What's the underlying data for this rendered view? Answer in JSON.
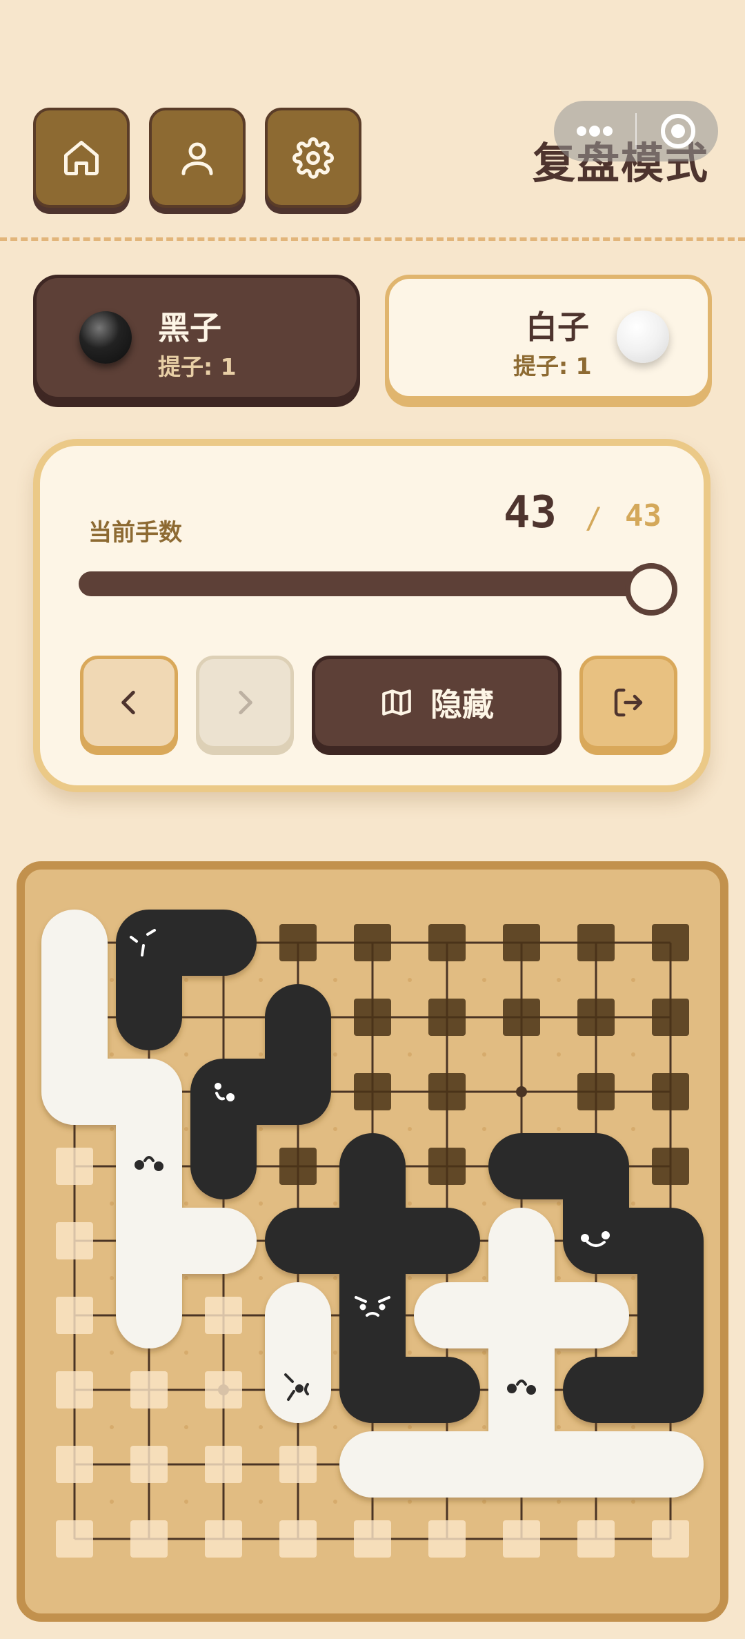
{
  "header": {
    "mode_title": "复盘模式",
    "buttons": [
      {
        "name": "home",
        "icon": "home-icon"
      },
      {
        "name": "profile",
        "icon": "user-icon"
      },
      {
        "name": "settings",
        "icon": "gear-icon"
      }
    ],
    "capsule_icons": [
      "more-dots-icon",
      "target-close-icon"
    ]
  },
  "players": {
    "black": {
      "name": "黑子",
      "captures": "提子: 1"
    },
    "white": {
      "name": "白子",
      "captures": "提子: 1"
    }
  },
  "replay": {
    "label": "当前手数",
    "current": "43",
    "separator": "/",
    "total": "43",
    "progress": 1.0,
    "hide_label": "隐藏",
    "prev_icon": "chevron-left-icon",
    "next_icon": "chevron-right-icon",
    "hide_icon": "map-icon",
    "exit_icon": "exit-icon"
  },
  "board": {
    "size": 9,
    "star_points": [
      [
        6,
        2
      ],
      [
        2,
        6
      ]
    ],
    "black_groups": [
      {
        "face": "surprised",
        "cells": [
          [
            1,
            0
          ],
          [
            2,
            0
          ],
          [
            1,
            1
          ]
        ]
      },
      {
        "face": "confused",
        "cells": [
          [
            3,
            1
          ],
          [
            3,
            2
          ],
          [
            2,
            2
          ],
          [
            2,
            3
          ]
        ]
      },
      {
        "face": "angry",
        "cells": [
          [
            4,
            3
          ],
          [
            4,
            4
          ],
          [
            3,
            4
          ],
          [
            5,
            4
          ],
          [
            4,
            5
          ],
          [
            4,
            6
          ],
          [
            5,
            6
          ]
        ]
      },
      {
        "face": "smile",
        "cells": [
          [
            6,
            3
          ],
          [
            7,
            3
          ],
          [
            7,
            4
          ],
          [
            8,
            4
          ],
          [
            8,
            5
          ],
          [
            8,
            6
          ],
          [
            7,
            6
          ]
        ]
      }
    ],
    "white_groups": [
      {
        "face": "sleepy",
        "cells": [
          [
            0,
            0
          ],
          [
            0,
            1
          ],
          [
            0,
            2
          ],
          [
            1,
            2
          ],
          [
            1,
            3
          ],
          [
            1,
            4
          ],
          [
            2,
            4
          ],
          [
            1,
            5
          ]
        ]
      },
      {
        "face": "dizzy",
        "cells": [
          [
            3,
            5
          ],
          [
            3,
            6
          ]
        ]
      },
      {
        "face": "sleepy",
        "cells": [
          [
            6,
            4
          ],
          [
            6,
            5
          ],
          [
            5,
            5
          ],
          [
            7,
            5
          ],
          [
            6,
            6
          ],
          [
            6,
            7
          ],
          [
            4,
            7
          ],
          [
            5,
            7
          ],
          [
            7,
            7
          ],
          [
            8,
            7
          ]
        ]
      }
    ],
    "black_territory": [
      [
        3,
        0
      ],
      [
        4,
        0
      ],
      [
        5,
        0
      ],
      [
        6,
        0
      ],
      [
        7,
        0
      ],
      [
        8,
        0
      ],
      [
        4,
        1
      ],
      [
        5,
        1
      ],
      [
        6,
        1
      ],
      [
        7,
        1
      ],
      [
        8,
        1
      ],
      [
        4,
        2
      ],
      [
        5,
        2
      ],
      [
        7,
        2
      ],
      [
        8,
        2
      ],
      [
        3,
        3
      ],
      [
        5,
        3
      ],
      [
        8,
        3
      ]
    ],
    "white_territory": [
      [
        0,
        3
      ],
      [
        0,
        4
      ],
      [
        0,
        5
      ],
      [
        2,
        5
      ],
      [
        0,
        6
      ],
      [
        1,
        6
      ],
      [
        2,
        6
      ],
      [
        0,
        7
      ],
      [
        1,
        7
      ],
      [
        2,
        7
      ],
      [
        3,
        7
      ],
      [
        0,
        8
      ],
      [
        1,
        8
      ],
      [
        2,
        8
      ],
      [
        3,
        8
      ],
      [
        4,
        8
      ],
      [
        5,
        8
      ],
      [
        6,
        8
      ],
      [
        7,
        8
      ],
      [
        8,
        8
      ]
    ],
    "colors": {
      "black_stone": "#2b2a2a",
      "white_stone": "#f6f4ee",
      "black_marker": "#4a3418",
      "white_marker": "#fbe6c8",
      "line": "#4a3424"
    }
  }
}
